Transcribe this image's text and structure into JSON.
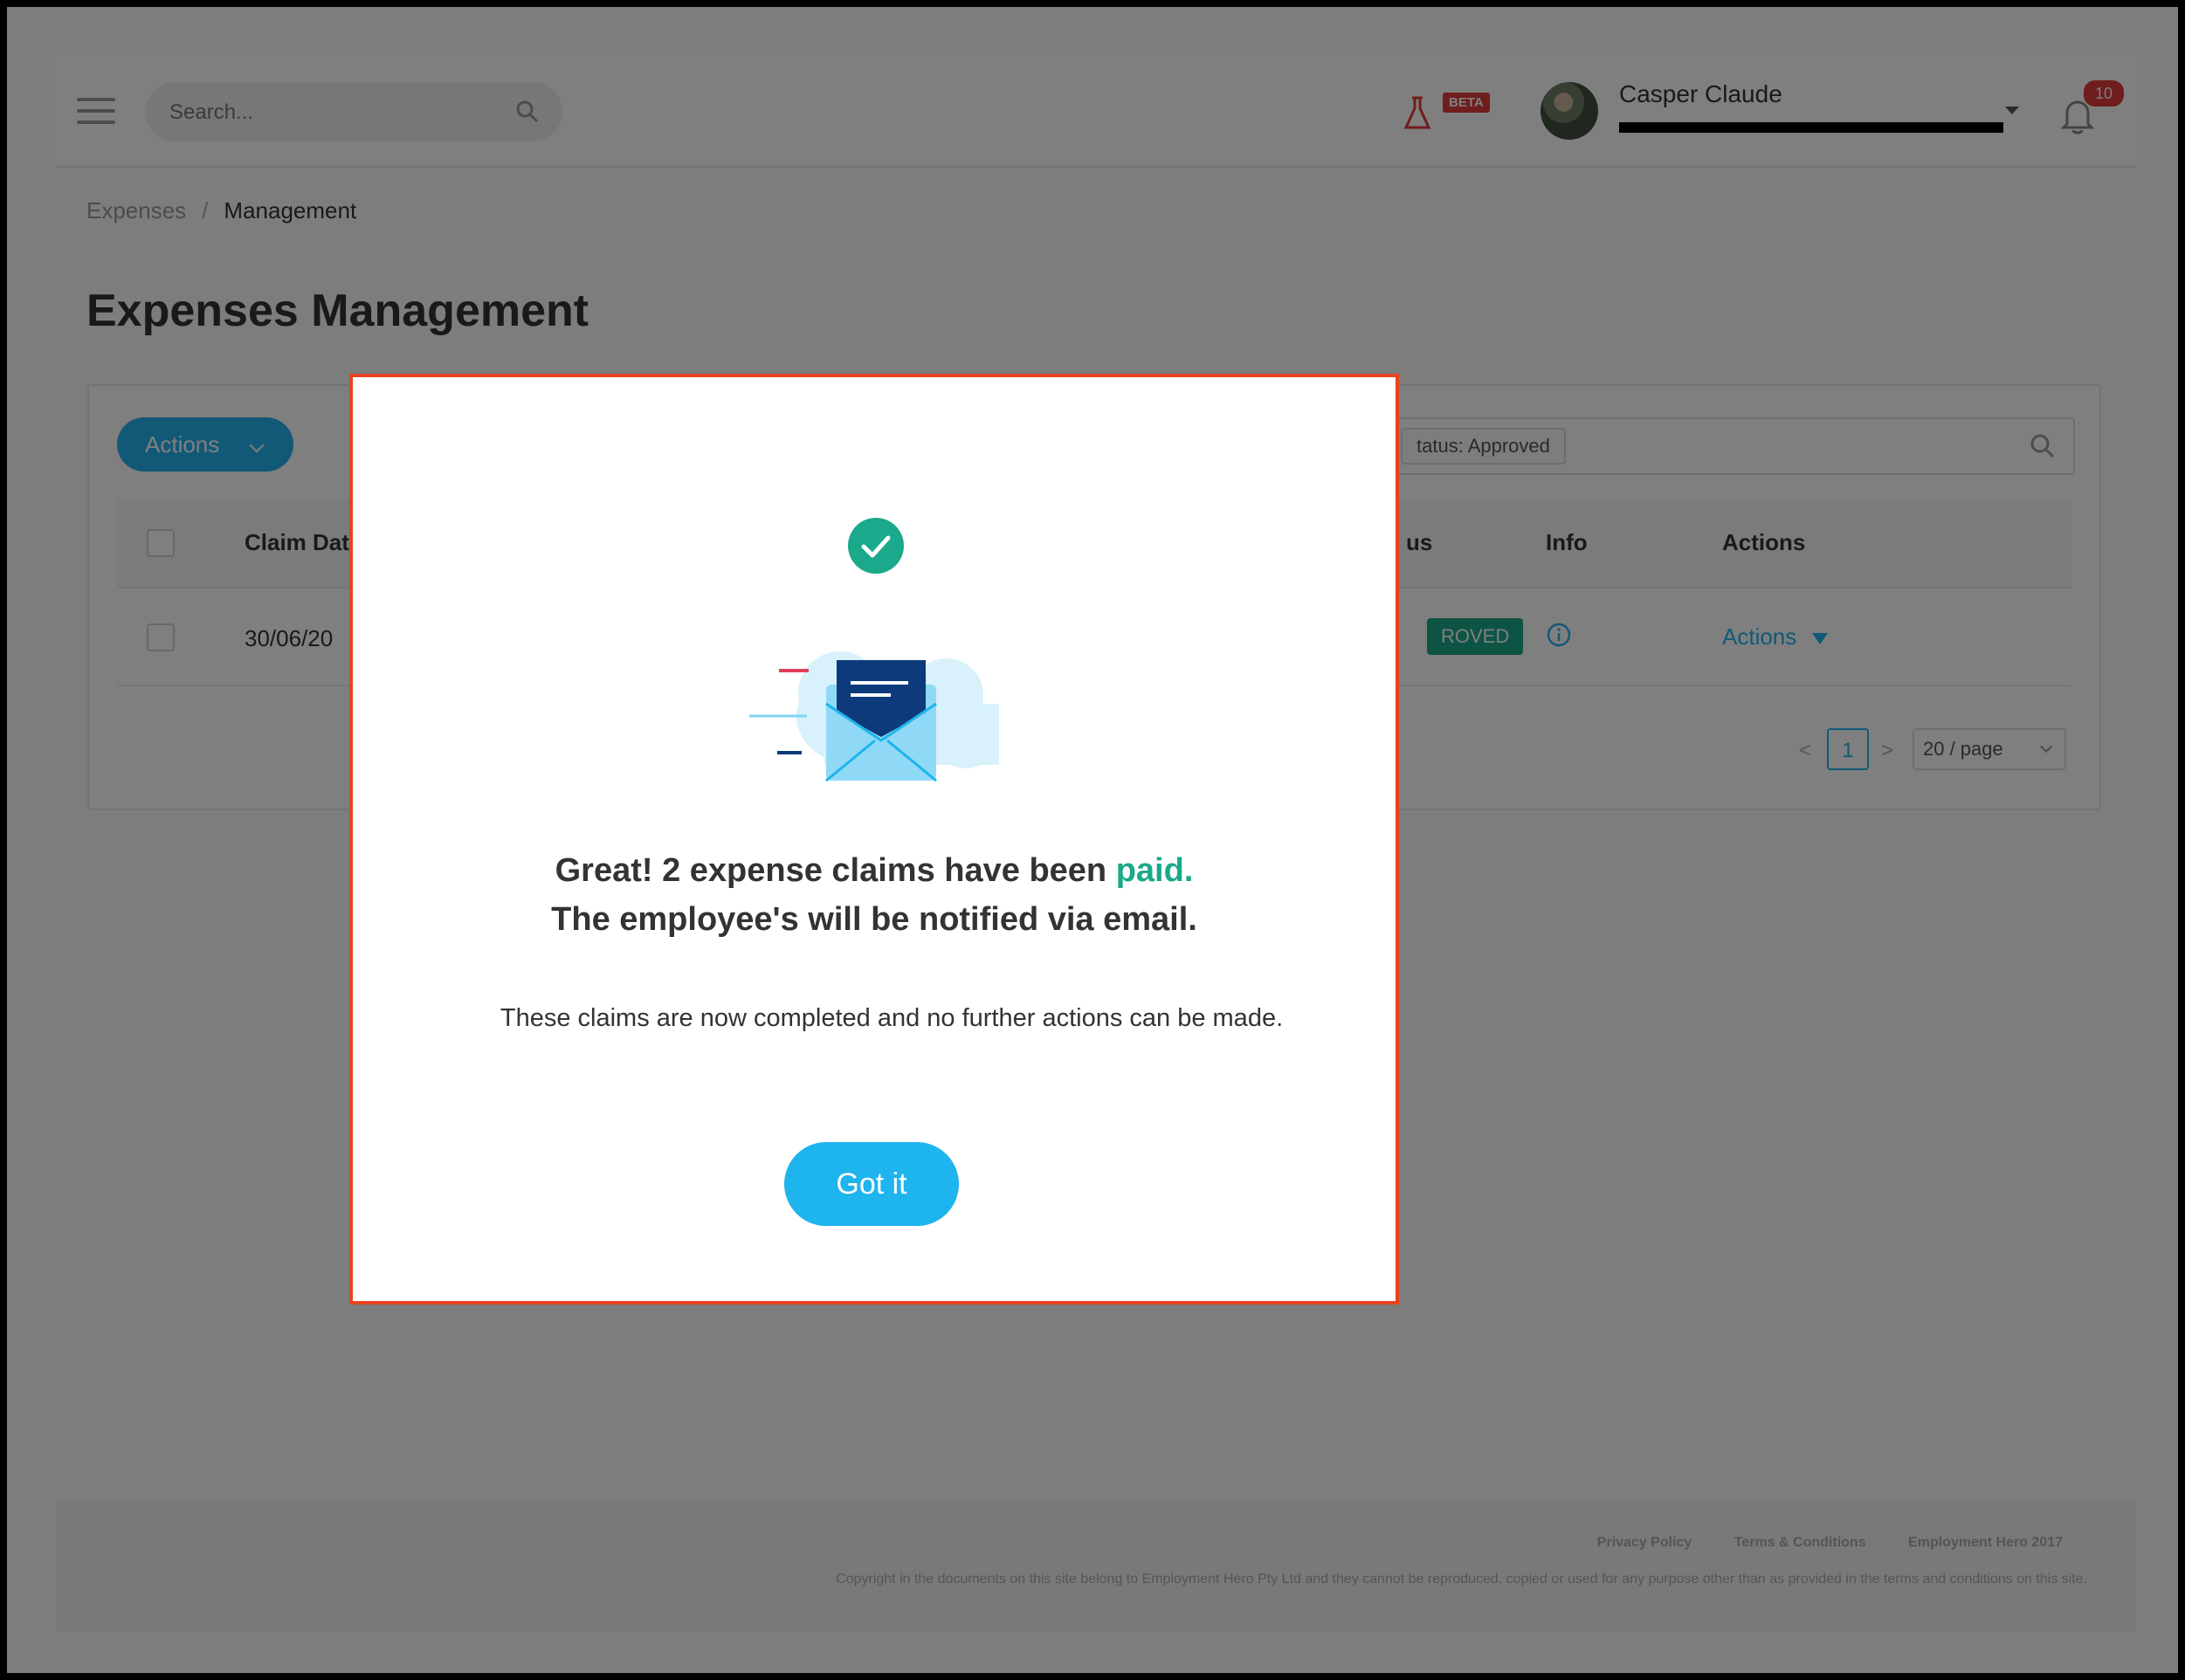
{
  "header": {
    "search_placeholder": "Search...",
    "beta_label": "BETA",
    "user_name": "Casper Claude",
    "notification_count": "10"
  },
  "breadcrumb": {
    "parent": "Expenses",
    "separator": "/",
    "current": "Management"
  },
  "page_title": "Expenses Management",
  "toolbar": {
    "actions_label": "Actions",
    "filter_tag": "Status: Approved",
    "filter_tag_visible": "tatus: Approved"
  },
  "table": {
    "columns": [
      "Claim Dat",
      "us",
      "Info",
      "Actions"
    ],
    "rows": [
      {
        "claim_date": "30/06/20",
        "status": "ROVED",
        "actions_label": "Actions"
      }
    ]
  },
  "pagination": {
    "prev": "<",
    "current_page": "1",
    "next": ">",
    "page_size": "20 / page"
  },
  "footer": {
    "links": [
      "Privacy Policy",
      "Terms & Conditions",
      "Employment Hero 2017"
    ],
    "copyright": "Copyright in the documents on this site belong to Employment Hero Pty Ltd and they cannot be reproduced, copied or used for any purpose other than as provided in the terms and conditions on this site."
  },
  "modal": {
    "line1_prefix": "Great! 2 expense claims have been ",
    "line1_highlight": "paid.",
    "line2": "The employee's will be notified via email.",
    "note": "These claims are now completed and no further actions can be made.",
    "button_label": "Got it"
  },
  "colors": {
    "accent": "#25b2ee",
    "success": "#1aa98a",
    "modal_border": "#e8431f",
    "badge_red": "#e03a3a"
  },
  "icons": [
    "hamburger-icon",
    "search-icon",
    "flask-icon",
    "chevron-down-icon",
    "bell-icon",
    "info-icon",
    "check-circle-icon",
    "envelope-illustration"
  ]
}
